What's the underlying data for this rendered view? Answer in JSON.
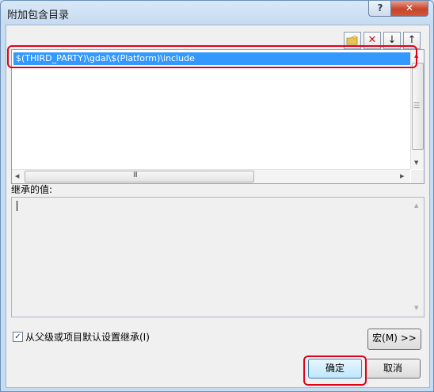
{
  "window": {
    "title": "附加包含目录",
    "help_label": "?",
    "close_label": "✕"
  },
  "toolbar": {
    "new_line_icon": "folder-icon",
    "delete_label": "✕",
    "move_down_label": "↓",
    "move_up_label": "↑"
  },
  "list": {
    "items": [
      "$(THIRD_PARTY)\\gdal\\$(Platform)\\include"
    ]
  },
  "scroll": {
    "grip": "III"
  },
  "inherited": {
    "label": "继承的值:"
  },
  "options": {
    "inherit_checked": true,
    "inherit_label": "从父级或项目默认设置继承(I)",
    "check_mark": "✓"
  },
  "buttons": {
    "macros_label": "宏(M) >>",
    "ok_label": "确定",
    "cancel_label": "取消"
  },
  "colors": {
    "selection": "#3399ff",
    "highlight": "#e1001a"
  }
}
